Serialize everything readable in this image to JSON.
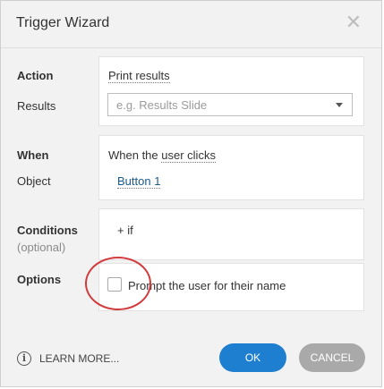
{
  "dialog": {
    "title": "Trigger Wizard",
    "close_glyph": "✕"
  },
  "action": {
    "label": "Action",
    "value": "Print results"
  },
  "results": {
    "label": "Results",
    "placeholder": "e.g. Results Slide"
  },
  "when": {
    "label": "When",
    "prefix": "When the ",
    "value": "user clicks"
  },
  "object": {
    "label": "Object",
    "value": "Button 1"
  },
  "conditions": {
    "label": "Conditions",
    "sublabel": "(optional)",
    "add_text": "+ if"
  },
  "options": {
    "label": "Options",
    "checkbox_label": "Prompt the user for their name",
    "checked": false
  },
  "footer": {
    "info_glyph": "i",
    "learn_more": "LEARN MORE...",
    "ok": "OK",
    "cancel": "CANCEL"
  },
  "colors": {
    "ok_button": "#1e7fd0",
    "cancel_button": "#a9a9a9",
    "highlight_circle": "#d23b3b"
  },
  "icons": [
    "close-icon",
    "dropdown-caret-icon",
    "info-icon"
  ]
}
